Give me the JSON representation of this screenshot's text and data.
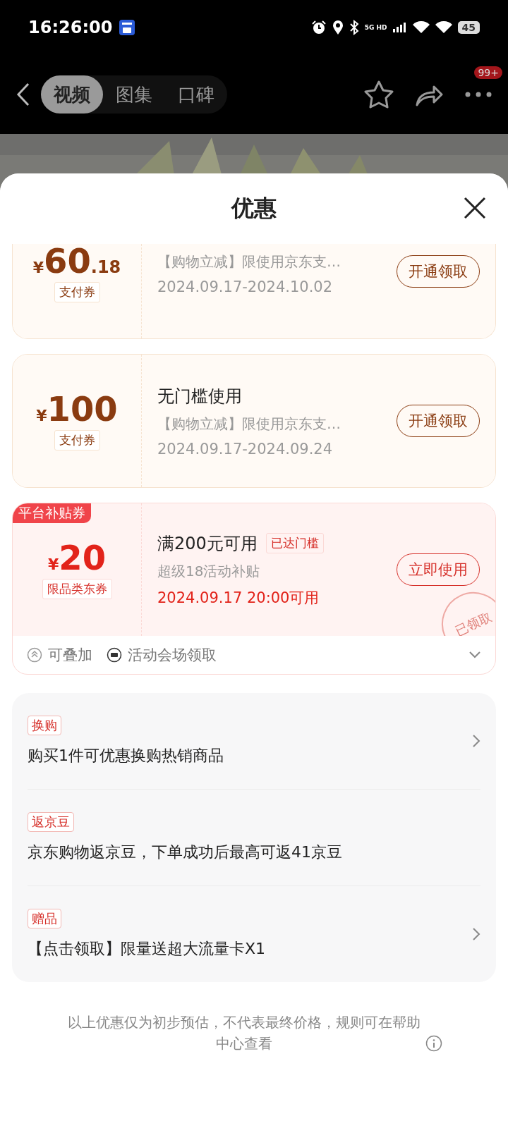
{
  "status_bar": {
    "time": "16:26:00",
    "network": "5G HD",
    "battery": "45"
  },
  "nav": {
    "tabs": [
      {
        "label": "视频",
        "selected": true
      },
      {
        "label": "图集",
        "selected": false
      },
      {
        "label": "口碑",
        "selected": false
      }
    ],
    "badge": "99+"
  },
  "sheet": {
    "title": "优惠"
  },
  "coupons": [
    {
      "kind": "pay",
      "currency": "¥",
      "amount": "60",
      "decimals": ".18",
      "type_tag": "支付券",
      "description": "【购物立减】限使用京东支…",
      "validity": "2024.09.17-2024.10.02",
      "button": "开通领取"
    },
    {
      "kind": "pay",
      "currency": "¥",
      "amount": "100",
      "type_tag": "支付券",
      "title": "无门槛使用",
      "description": "【购物立减】限使用京东支…",
      "validity": "2024.09.17-2024.09.24",
      "button": "开通领取"
    },
    {
      "kind": "platform",
      "corner_label": "平台补贴券",
      "currency": "¥",
      "amount": "20",
      "type_tag": "限品类东券",
      "title": "满200元可用",
      "status_tag": "已达门槛",
      "description": "超级18活动补贴",
      "validity": "2024.09.17 20:00可用",
      "button": "立即使用",
      "stamp": "已领取",
      "features": [
        "可叠加",
        "活动会场领取"
      ]
    }
  ],
  "promos": [
    {
      "tag": "换购",
      "text": "购买1件可优惠换购热销商品",
      "arrow": true
    },
    {
      "tag": "返京豆",
      "text": "京东购物返京豆，下单成功后最高可返41京豆",
      "arrow": false
    },
    {
      "tag": "赠品",
      "text": "【点击领取】限量送超大流量卡X1",
      "arrow": true
    }
  ],
  "notice": "以上优惠仅为初步预估，不代表最终价格，规则可在帮助中心查看"
}
